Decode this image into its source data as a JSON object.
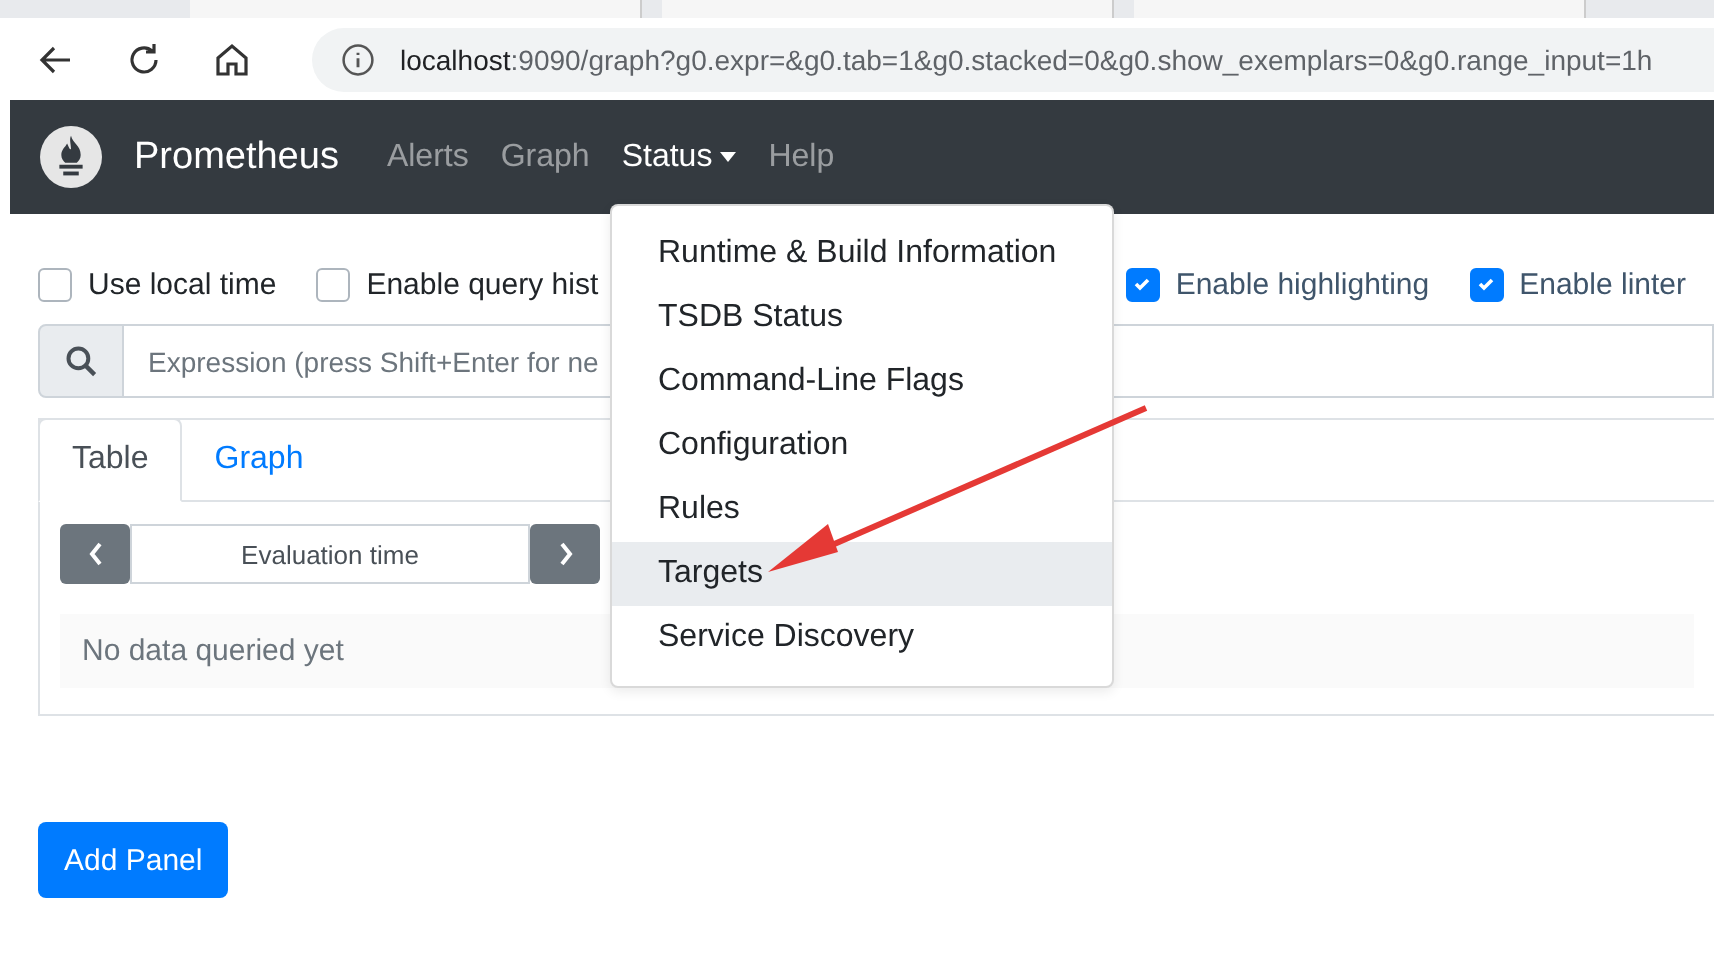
{
  "browser": {
    "url_host": "localhost",
    "url_rest": ":9090/graph?g0.expr=&g0.tab=1&g0.stacked=0&g0.show_exemplars=0&g0.range_input=1h"
  },
  "navbar": {
    "brand": "Prometheus",
    "links": [
      {
        "label": "Alerts",
        "active": false,
        "dropdown": false
      },
      {
        "label": "Graph",
        "active": false,
        "dropdown": false
      },
      {
        "label": "Status",
        "active": true,
        "dropdown": true
      },
      {
        "label": "Help",
        "active": false,
        "dropdown": false
      }
    ]
  },
  "options": [
    {
      "label": "Use local time",
      "checked": false
    },
    {
      "label": "Enable query hist",
      "checked": false
    },
    {
      "label": "Enable highlighting",
      "checked": true
    },
    {
      "label": "Enable linter",
      "checked": true
    }
  ],
  "expression": {
    "placeholder": "Expression (press Shift+Enter for ne"
  },
  "panel": {
    "tabs": [
      {
        "label": "Table",
        "selected": true
      },
      {
        "label": "Graph",
        "selected": false
      }
    ],
    "evaluation_time": {
      "placeholder": "Evaluation time"
    },
    "message": "No data queried yet"
  },
  "add_panel_button": "Add Panel",
  "status_menu": {
    "items": [
      {
        "label": "Runtime & Build Information",
        "selected": false
      },
      {
        "label": "TSDB Status",
        "selected": false
      },
      {
        "label": "Command-Line Flags",
        "selected": false
      },
      {
        "label": "Configuration",
        "selected": false
      },
      {
        "label": "Rules",
        "selected": false
      },
      {
        "label": "Targets",
        "selected": true
      },
      {
        "label": "Service Discovery",
        "selected": false
      }
    ]
  }
}
